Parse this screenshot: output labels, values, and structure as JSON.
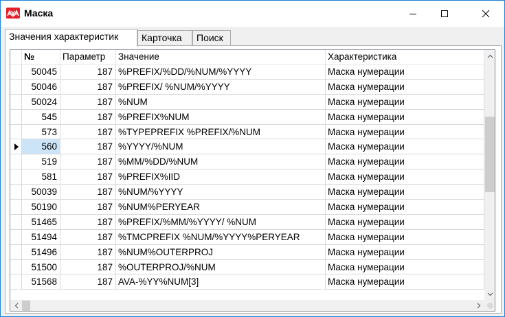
{
  "window": {
    "title": "Маска",
    "logo_icon": "ava-logo-icon",
    "brand_color": "#e3202a"
  },
  "titlebar_buttons": {
    "minimize_icon": "minimize-icon",
    "maximize_icon": "maximize-icon",
    "close_icon": "close-icon"
  },
  "tabs": [
    {
      "label": "Значения характеристик",
      "active": true
    },
    {
      "label": "Карточка",
      "active": false
    },
    {
      "label": "Поиск",
      "active": false
    }
  ],
  "table": {
    "columns": [
      "№",
      "Параметр",
      "Значение",
      "Характеристика"
    ],
    "current_row_index": 5,
    "selection_color": "#cce4f7",
    "rows": [
      {
        "no": "50045",
        "param": "187",
        "value": "%PREFIX/%DD/%NUM/%YYYY",
        "characteristic": "Маска нумерации"
      },
      {
        "no": "50046",
        "param": "187",
        "value": "%PREFIX/ %NUM/%YYYY",
        "characteristic": "Маска нумерации"
      },
      {
        "no": "50024",
        "param": "187",
        "value": "%NUM",
        "characteristic": "Маска нумерации"
      },
      {
        "no": "545",
        "param": "187",
        "value": "%PREFIX%NUM",
        "characteristic": "Маска нумерации"
      },
      {
        "no": "573",
        "param": "187",
        "value": "%TYPEPREFIX %PREFIX/%NUM",
        "characteristic": "Маска нумерации"
      },
      {
        "no": "560",
        "param": "187",
        "value": "%YYYY/%NUM",
        "characteristic": "Маска нумерации"
      },
      {
        "no": "519",
        "param": "187",
        "value": "%MM/%DD/%NUM",
        "characteristic": "Маска нумерации"
      },
      {
        "no": "581",
        "param": "187",
        "value": "%PREFIX%IID",
        "characteristic": "Маска нумерации"
      },
      {
        "no": "50039",
        "param": "187",
        "value": "%NUM/%YYYY",
        "characteristic": "Маска нумерации"
      },
      {
        "no": "50190",
        "param": "187",
        "value": "%NUM%PERYEAR",
        "characteristic": "Маска нумерации"
      },
      {
        "no": "51465",
        "param": "187",
        "value": "%PREFIX/%MM/%YYYY/ %NUM",
        "characteristic": "Маска нумерации"
      },
      {
        "no": "51494",
        "param": "187",
        "value": "%TMCPREFIX %NUM/%YYYY%PERYEAR",
        "characteristic": "Маска нумерации"
      },
      {
        "no": "51496",
        "param": "187",
        "value": "%NUM%OUTERPROJ",
        "characteristic": "Маска нумерации"
      },
      {
        "no": "51500",
        "param": "187",
        "value": "%OUTERPROJ/%NUM",
        "characteristic": "Маска нумерации"
      },
      {
        "no": "51568",
        "param": "187",
        "value": "AVA-%YY%NUM[3]",
        "characteristic": "Маска нумерации"
      }
    ]
  }
}
